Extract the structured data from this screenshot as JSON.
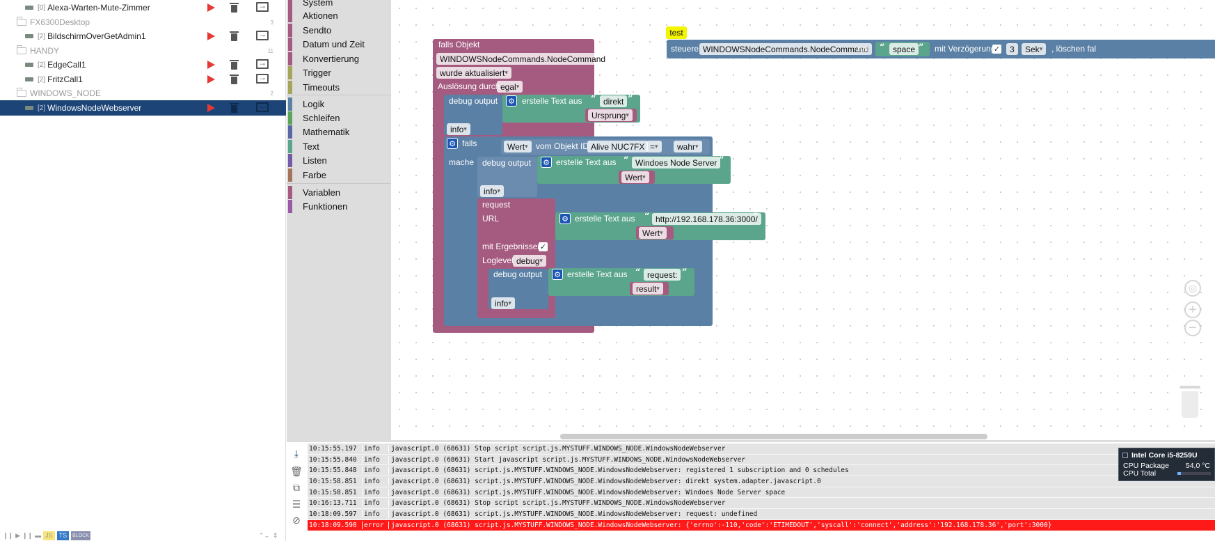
{
  "tree": {
    "items": [
      {
        "type": "script",
        "num": "[0]",
        "name": "Alexa-Warten-Mute-Zimmer",
        "selected": false
      },
      {
        "type": "folder",
        "name": "FX6300Desktop",
        "count": "3"
      },
      {
        "type": "script",
        "num": "[2]",
        "name": "BildschirmOverGetAdmin1",
        "selected": false
      },
      {
        "type": "folder",
        "name": "HANDY",
        "count": "11"
      },
      {
        "type": "script",
        "num": "[2]",
        "name": "EdgeCall1",
        "selected": false
      },
      {
        "type": "script",
        "num": "[2]",
        "name": "FritzCall1",
        "selected": false
      },
      {
        "type": "folder",
        "name": "WINDOWS_NODE",
        "count": "2"
      },
      {
        "type": "script",
        "num": "[2]",
        "name": "WindowsNodeWebserver",
        "selected": true
      }
    ],
    "bottom_icons": [
      "pause-icon",
      "play-icon",
      "pause-icon",
      "thumb-icon",
      "JS",
      "TS",
      "BLOCKLY"
    ],
    "bottom_js": "JS",
    "bottom_ts": "TS",
    "bottom_blk": "BLOCK"
  },
  "toolbox": {
    "categories": [
      {
        "label": "System",
        "color": "#a55b80"
      },
      {
        "label": "Aktionen",
        "color": "#a55b80"
      },
      {
        "label": "Sendto",
        "color": "#a55b80"
      },
      {
        "label": "Datum und Zeit",
        "color": "#a55b80"
      },
      {
        "label": "Konvertierung",
        "color": "#a55b80"
      },
      {
        "label": "Trigger",
        "color": "#a5a55b"
      },
      {
        "label": "Timeouts",
        "color": "#a5a55b"
      },
      {
        "label": "Logik",
        "color": "#5b80a5"
      },
      {
        "label": "Schleifen",
        "color": "#5ba55b"
      },
      {
        "label": "Mathematik",
        "color": "#5b67a5"
      },
      {
        "label": "Text",
        "color": "#5ba58c"
      },
      {
        "label": "Listen",
        "color": "#745ba5"
      },
      {
        "label": "Farbe",
        "color": "#a5745b"
      },
      {
        "label": "Variablen",
        "color": "#a55b80"
      },
      {
        "label": "Funktionen",
        "color": "#995ba5"
      }
    ]
  },
  "blocks": {
    "trigger_title": "falls Objekt",
    "trigger_object": "WINDOWSNodeCommands.NodeCommand",
    "trigger_event": "wurde aktualisiert",
    "trigger_by_label": "Auslösung durch",
    "trigger_by": "egal",
    "debug_label": "debug output",
    "create_text": "erstelle Text aus",
    "text_direkt": "direkt",
    "ursprung": "Ursprung",
    "level_info": "info",
    "if_label": "falls",
    "do_label": "mache",
    "wert": "Wert",
    "from_obj": "vom Objekt ID",
    "obj_id": "Alive NUC7FX",
    "eq": "=",
    "wahr": "wahr",
    "text_server": "Windoes Node Server",
    "request_label": "request",
    "url_label": "URL",
    "url_value": "http://192.168.178.36:3000/",
    "with_results": "mit Ergebnissen",
    "loglevel_label": "Loglevel",
    "loglevel": "debug",
    "text_request": "request:",
    "result": "result",
    "comment_test": "test",
    "control_label": "steuere",
    "control_object": "WINDOWSNodeCommands.NodeCommand",
    "mit": "mit",
    "text_space": "space",
    "delay_label": "mit Verzögerung",
    "delay_value": "3",
    "delay_unit": "Sek",
    "clear_label": ", löschen fal"
  },
  "log": {
    "rows": [
      {
        "ts": "10:15:55.197",
        "sev": "info",
        "msg": "javascript.0 (68631) Stop script script.js.MYSTUFF.WINDOWS_NODE.WindowsNodeWebserver"
      },
      {
        "ts": "10:15:55.840",
        "sev": "info",
        "msg": "javascript.0 (68631) Start javascript script.js.MYSTUFF.WINDOWS_NODE.WindowsNodeWebserver"
      },
      {
        "ts": "10:15:55.848",
        "sev": "info",
        "msg": "javascript.0 (68631) script.js.MYSTUFF.WINDOWS_NODE.WindowsNodeWebserver: registered 1 subscription and 0 schedules"
      },
      {
        "ts": "10:15:58.851",
        "sev": "info",
        "msg": "javascript.0 (68631) script.js.MYSTUFF.WINDOWS_NODE.WindowsNodeWebserver: direkt system.adapter.javascript.0"
      },
      {
        "ts": "10:15:58.851",
        "sev": "info",
        "msg": "javascript.0 (68631) script.js.MYSTUFF.WINDOWS_NODE.WindowsNodeWebserver: Windoes Node Server space"
      },
      {
        "ts": "10:16:13.711",
        "sev": "info",
        "msg": "javascript.0 (68631) Stop script script.js.MYSTUFF.WINDOWS_NODE.WindowsNodeWebserver"
      },
      {
        "ts": "10:18:09.597",
        "sev": "info",
        "msg": "javascript.0 (68631) script.js.MYSTUFF.WINDOWS_NODE.WindowsNodeWebserver: request: undefined"
      },
      {
        "ts": "10:18:09.598",
        "sev": "error",
        "msg": "javascript.0 (68631) script.js.MYSTUFF.WINDOWS_NODE.WindowsNodeWebserver: {'errno':-110,'code':'ETIMEDOUT','syscall':'connect','address':'192.168.178.36','port':3000}"
      }
    ]
  },
  "cpu": {
    "title": "Intel Core i5-8259U",
    "package_label": "CPU Package",
    "package_value": "54,0 °C",
    "total_label": "CPU Total",
    "total_fraction": 0.1
  },
  "colors": {
    "selected": "#1c4477",
    "error_row": "#ff1a1a",
    "run": "#e53935"
  }
}
